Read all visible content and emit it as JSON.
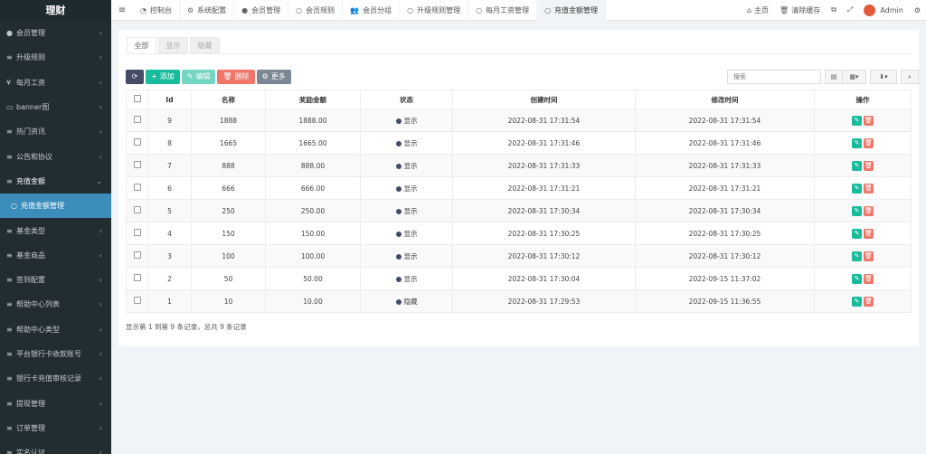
{
  "brand": "理财",
  "sidebar": {
    "items": [
      {
        "icon": "●",
        "label": "会员管理",
        "chev": "‹",
        "cls": ""
      },
      {
        "icon": "≡",
        "label": "升级规则",
        "chev": "‹",
        "cls": ""
      },
      {
        "icon": "¥",
        "label": "每月工资",
        "chev": "‹",
        "cls": ""
      },
      {
        "icon": "▭",
        "label": "banner图",
        "chev": "‹",
        "cls": ""
      },
      {
        "icon": "≡",
        "label": "热门资讯",
        "chev": "‹",
        "cls": ""
      },
      {
        "icon": "≡",
        "label": "公告和协议",
        "chev": "‹",
        "cls": ""
      },
      {
        "icon": "≡",
        "label": "充值金额",
        "chev": "⌄",
        "cls": "open"
      },
      {
        "icon": "○",
        "label": "充值金额管理",
        "chev": "",
        "cls": "active"
      },
      {
        "icon": "≡",
        "label": "基金类型",
        "chev": "‹",
        "cls": ""
      },
      {
        "icon": "≡",
        "label": "基金商品",
        "chev": "‹",
        "cls": ""
      },
      {
        "icon": "≡",
        "label": "签到配置",
        "chev": "‹",
        "cls": ""
      },
      {
        "icon": "≡",
        "label": "帮助中心列表",
        "chev": "‹",
        "cls": ""
      },
      {
        "icon": "≡",
        "label": "帮助中心类型",
        "chev": "‹",
        "cls": ""
      },
      {
        "icon": "≡",
        "label": "平台银行卡收款账号",
        "chev": "‹",
        "cls": ""
      },
      {
        "icon": "≡",
        "label": "银行卡充值审核记录",
        "chev": "‹",
        "cls": ""
      },
      {
        "icon": "≡",
        "label": "提现管理",
        "chev": "‹",
        "cls": ""
      },
      {
        "icon": "≡",
        "label": "订单管理",
        "chev": "‹",
        "cls": ""
      },
      {
        "icon": "≡",
        "label": "实名认证",
        "chev": "‹",
        "cls": ""
      }
    ]
  },
  "topbar": {
    "hamburger": "≡",
    "tabs": [
      {
        "icon": "◔",
        "label": "控制台",
        "active": false
      },
      {
        "icon": "⚙",
        "label": "系统配置",
        "active": false
      },
      {
        "icon": "●",
        "label": "会员管理",
        "active": false
      },
      {
        "icon": "○",
        "label": "会员规则",
        "active": false
      },
      {
        "icon": "👥",
        "label": "会员分组",
        "active": false
      },
      {
        "icon": "○",
        "label": "升级规则管理",
        "active": false
      },
      {
        "icon": "○",
        "label": "每月工资管理",
        "active": false
      },
      {
        "icon": "○",
        "label": "充值金额管理",
        "active": true
      }
    ],
    "right": {
      "home": "主页",
      "clear_cache": "清除缓存",
      "admin": "Admin"
    }
  },
  "panel": {
    "tabs": [
      "全部",
      "显示",
      "隐藏"
    ],
    "toolbar": {
      "refresh": "⟳",
      "add": "添加",
      "edit": "编辑",
      "delete": "删除",
      "more": "更多"
    },
    "search_placeholder": "搜索",
    "columns": [
      "",
      "Id",
      "名称",
      "奖励金额",
      "状态",
      "创建时间",
      "修改时间",
      "操作"
    ],
    "rows": [
      {
        "id": "9",
        "name": "1888",
        "amount": "1888.00",
        "status": "显示",
        "created": "2022-08-31 17:31:54",
        "updated": "2022-08-31 17:31:54"
      },
      {
        "id": "8",
        "name": "1665",
        "amount": "1665.00",
        "status": "显示",
        "created": "2022-08-31 17:31:46",
        "updated": "2022-08-31 17:31:46"
      },
      {
        "id": "7",
        "name": "888",
        "amount": "888.00",
        "status": "显示",
        "created": "2022-08-31 17:31:33",
        "updated": "2022-08-31 17:31:33"
      },
      {
        "id": "6",
        "name": "666",
        "amount": "666.00",
        "status": "显示",
        "created": "2022-08-31 17:31:21",
        "updated": "2022-08-31 17:31:21"
      },
      {
        "id": "5",
        "name": "250",
        "amount": "250.00",
        "status": "显示",
        "created": "2022-08-31 17:30:34",
        "updated": "2022-08-31 17:30:34"
      },
      {
        "id": "4",
        "name": "150",
        "amount": "150.00",
        "status": "显示",
        "created": "2022-08-31 17:30:25",
        "updated": "2022-08-31 17:30:25"
      },
      {
        "id": "3",
        "name": "100",
        "amount": "100.00",
        "status": "显示",
        "created": "2022-08-31 17:30:12",
        "updated": "2022-08-31 17:30:12"
      },
      {
        "id": "2",
        "name": "50",
        "amount": "50.00",
        "status": "显示",
        "created": "2022-08-31 17:30:04",
        "updated": "2022-09-15 11:37:02"
      },
      {
        "id": "1",
        "name": "10",
        "amount": "10.00",
        "status": "隐藏",
        "created": "2022-08-31 17:29:53",
        "updated": "2022-09-15 11:36:55"
      }
    ],
    "footer": "显示第 1 到第 9 条记录，总共 9 条记录"
  }
}
